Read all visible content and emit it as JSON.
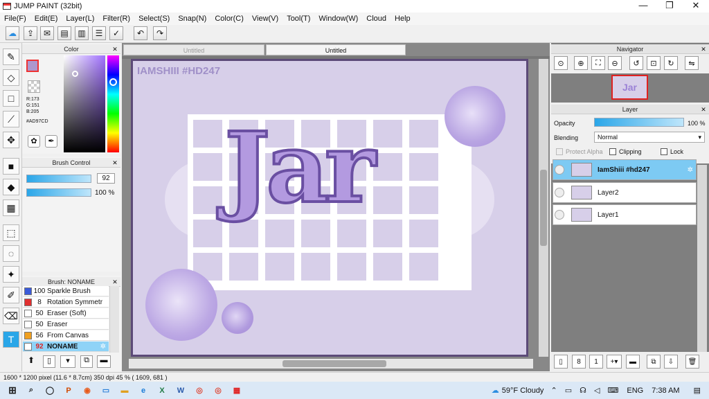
{
  "window": {
    "title": "JUMP PAINT (32bit)",
    "min": "—",
    "max": "❐",
    "close": "✕"
  },
  "menu": [
    "File(F)",
    "Edit(E)",
    "Layer(L)",
    "Filter(R)",
    "Select(S)",
    "Snap(N)",
    "Color(C)",
    "View(V)",
    "Tool(T)",
    "Window(W)",
    "Cloud",
    "Help"
  ],
  "color_panel": {
    "title": "Color",
    "r": "R:173",
    "g": "G:151",
    "b": "B:205",
    "hex": "#AD97CD",
    "main_color": "#AD97CD"
  },
  "brush_control": {
    "title": "Brush Control",
    "size": "92",
    "opacity": "100 %"
  },
  "brush_list": {
    "title": "Brush: NONAME",
    "items": [
      {
        "n": "100",
        "name": "Sparkle Brush",
        "color": "#3a5bd9"
      },
      {
        "n": "8",
        "name": "Rotation Symmetr",
        "color": "#e03030"
      },
      {
        "n": "50",
        "name": "Eraser (Soft)",
        "color": "#ffffff"
      },
      {
        "n": "50",
        "name": "Eraser",
        "color": "#ffffff"
      },
      {
        "n": "56",
        "name": "From Canvas",
        "color": "#f0a020"
      },
      {
        "n": "92",
        "name": "NONAME",
        "color": "#ffffff"
      }
    ]
  },
  "tabs": [
    "Untitled",
    "Untitled"
  ],
  "canvas": {
    "watermark": "IAMSHIII #HD247",
    "logo_text": "Jar",
    "bg": "#d7cfe9"
  },
  "navigator": {
    "title": "Navigator",
    "thumb_text": "Jar"
  },
  "layer_panel": {
    "title": "Layer",
    "opacity_label": "Opacity",
    "opacity_value": "100 %",
    "blending_label": "Blending",
    "blending_value": "Normal",
    "protect_alpha": "Protect Alpha",
    "clipping": "Clipping",
    "lock": "Lock",
    "layers": [
      {
        "name": "IamShiii #hd247"
      },
      {
        "name": "Layer2"
      },
      {
        "name": "Layer1"
      }
    ]
  },
  "status": "1600 * 1200 pixel   (11.6 * 8.7cm)   350 dpi   45 %   ( 1609, 681 )",
  "taskbar": {
    "weather": "59°F  Cloudy",
    "lang": "ENG",
    "time": "7:38 AM"
  }
}
